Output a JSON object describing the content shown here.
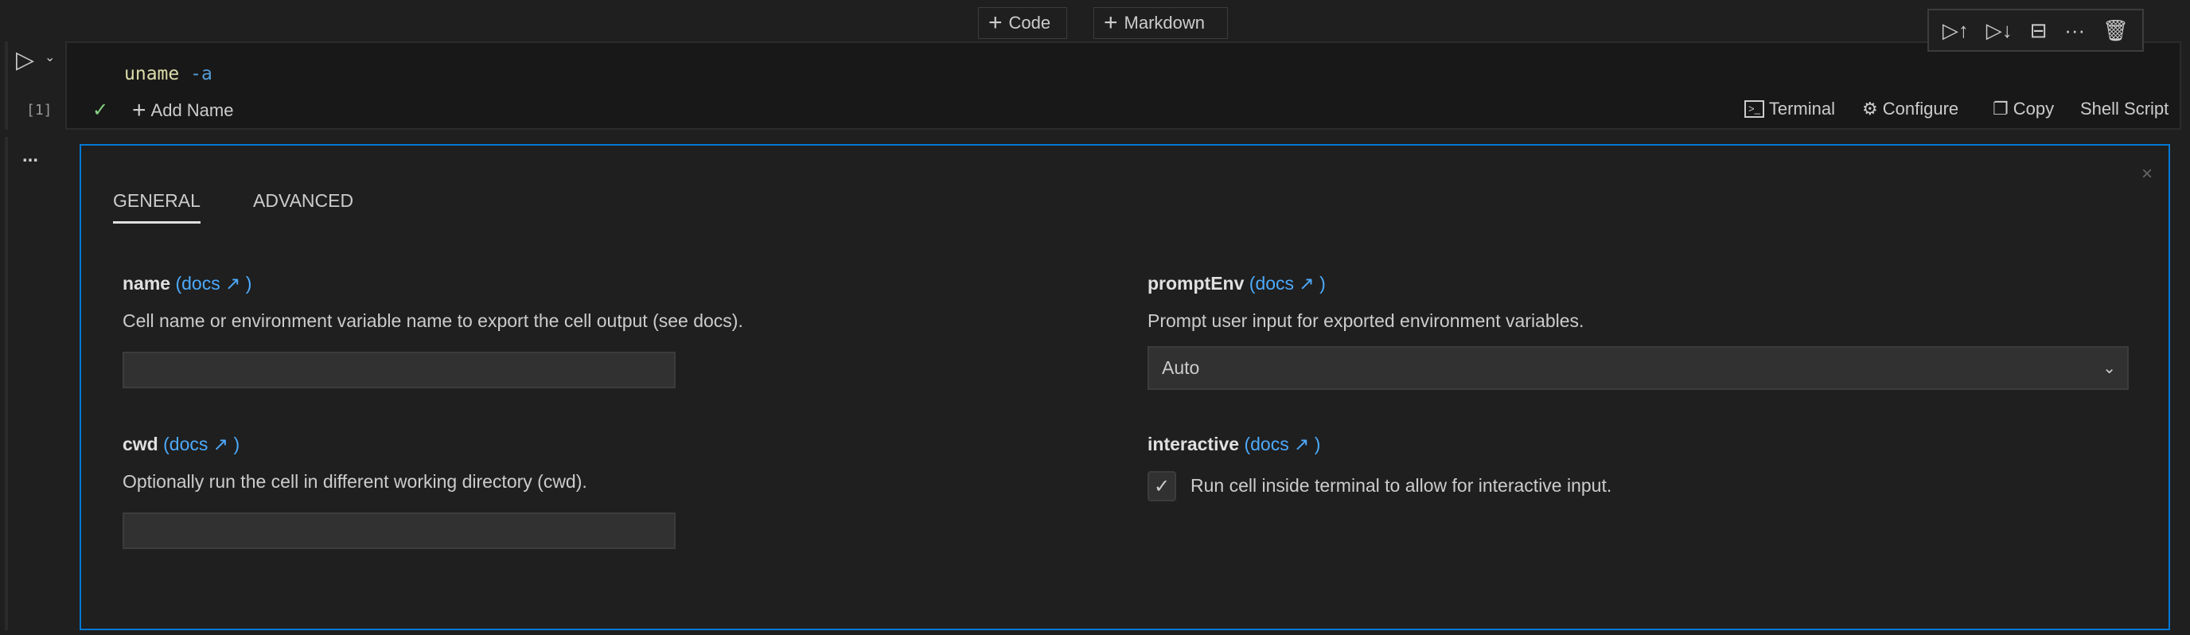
{
  "top_actions": {
    "add_code": "Code",
    "add_markdown": "Markdown"
  },
  "cell": {
    "execution_count": "[1]",
    "code": {
      "command": "uname",
      "flag": "-a"
    },
    "add_name": "Add Name",
    "status_items": {
      "terminal": "Terminal",
      "configure": "Configure",
      "copy": "Copy",
      "language": "Shell Script"
    }
  },
  "cell_toolbar": [
    "run-above-icon",
    "run-below-icon",
    "split-cell-icon",
    "more-icon",
    "delete-icon"
  ],
  "output_more": "...",
  "config": {
    "tabs": [
      {
        "label": "GENERAL",
        "active": true
      },
      {
        "label": "ADVANCED",
        "active": false
      }
    ],
    "fields": {
      "name": {
        "label": "name",
        "docs": "(docs",
        "docs_close": ")",
        "description": "Cell name or environment variable name to export the cell output (see docs).",
        "value": ""
      },
      "cwd": {
        "label": "cwd",
        "docs": "(docs",
        "docs_close": ")",
        "description": "Optionally run the cell in different working directory (cwd).",
        "value": ""
      },
      "promptEnv": {
        "label": "promptEnv",
        "docs": "(docs",
        "docs_close": ")",
        "description": "Prompt user input for exported environment variables.",
        "selected": "Auto"
      },
      "interactive": {
        "label": "interactive",
        "docs": "(docs",
        "docs_close": ")",
        "checkbox_label": "Run cell inside terminal to allow for interactive input.",
        "checked": true
      }
    }
  },
  "colors": {
    "accent": "#0078d4",
    "link": "#4daafc",
    "success": "#89d185",
    "background": "#1f1f1f"
  }
}
